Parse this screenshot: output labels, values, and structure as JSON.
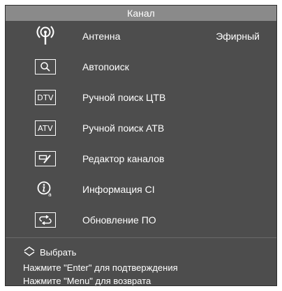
{
  "header": {
    "title": "Канал"
  },
  "menu": {
    "items": [
      {
        "icon": "antenna-icon",
        "label": "Антенна",
        "value": "Эфирный"
      },
      {
        "icon": "search-icon",
        "label": "Автопоиск"
      },
      {
        "icon": "dtv-icon",
        "icon_text": "DTV",
        "label": "Ручной поиск ЦТВ"
      },
      {
        "icon": "atv-icon",
        "icon_text": "ATV",
        "label": "Ручной поиск АТВ"
      },
      {
        "icon": "channel-edit-icon",
        "label": "Редактор каналов"
      },
      {
        "icon": "ci-info-icon",
        "label": "Информация CI"
      },
      {
        "icon": "software-update-icon",
        "label": "Обновление ПО"
      }
    ]
  },
  "footer": {
    "select_label": "Выбрать",
    "confirm_hint": "Нажмите \"Enter\" для подтверждения",
    "back_hint": "Нажмите \"Menu\" для возврата"
  },
  "colors": {
    "panel_bg": "#4d4d4d",
    "title_bar_bg": "#8a8a8a",
    "text": "#ffffff"
  }
}
